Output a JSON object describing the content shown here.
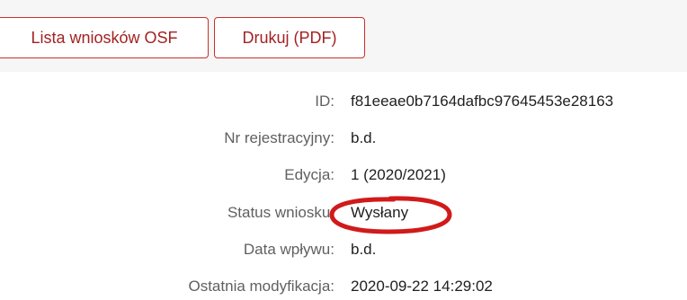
{
  "toolbar": {
    "list_button_label": "Lista wniosków OSF",
    "print_button_label": "Drukuj (PDF)"
  },
  "details": {
    "rows": [
      {
        "label": "ID:",
        "value": "f81eeae0b7164dafbc97645453e28163"
      },
      {
        "label": "Nr rejestracyjny:",
        "value": "b.d."
      },
      {
        "label": "Edycja:",
        "value": "1 (2020/2021)"
      },
      {
        "label": "Status wniosku:",
        "value": "Wysłany"
      },
      {
        "label": "Data wpływu:",
        "value": "b.d."
      },
      {
        "label": "Ostatnia modyfikacja:",
        "value": "2020-09-22 14:29:02"
      }
    ]
  },
  "colors": {
    "button_border": "#c9302c",
    "button_text": "#a32222",
    "annotation": "#d11a1a",
    "toolbar_bg": "#f6f6f6"
  }
}
